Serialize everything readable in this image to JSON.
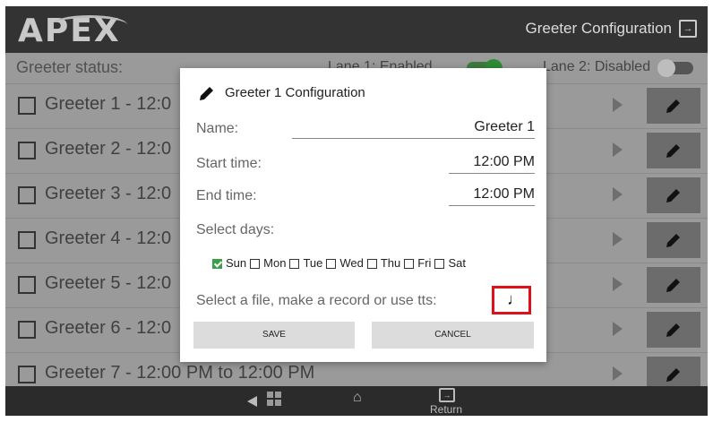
{
  "header": {
    "logo": "APEX",
    "title": "Greeter Configuration"
  },
  "status": {
    "label": "Greeter status:",
    "lane1": "Lane 1: Enabled",
    "lane2": "Lane 2: Disabled"
  },
  "greeters": [
    {
      "label": "Greeter 1 - 12:0"
    },
    {
      "label": "Greeter 2 - 12:0"
    },
    {
      "label": "Greeter 3 - 12:0"
    },
    {
      "label": "Greeter 4 - 12:0"
    },
    {
      "label": "Greeter 5 - 12:0"
    },
    {
      "label": "Greeter 6 - 12:0"
    },
    {
      "label": "Greeter 7 - 12:00 PM to 12:00 PM"
    }
  ],
  "dialog": {
    "title": "Greeter 1 Configuration",
    "name_label": "Name:",
    "name_value": "Greeter 1",
    "start_label": "Start time:",
    "start_value": "12:00 PM",
    "end_label": "End time:",
    "end_value": "12:00 PM",
    "days_label": "Select days:",
    "days": [
      {
        "label": "Sun",
        "checked": true
      },
      {
        "label": "Mon",
        "checked": false
      },
      {
        "label": "Tue",
        "checked": false
      },
      {
        "label": "Wed",
        "checked": false
      },
      {
        "label": "Thu",
        "checked": false
      },
      {
        "label": "Fri",
        "checked": false
      },
      {
        "label": "Sat",
        "checked": false
      }
    ],
    "file_label": "Select a file, make a record or use tts:",
    "music_glyph": "♩",
    "save": "SAVE",
    "cancel": "CANCEL"
  },
  "navbar": {
    "return_label": "Return"
  }
}
